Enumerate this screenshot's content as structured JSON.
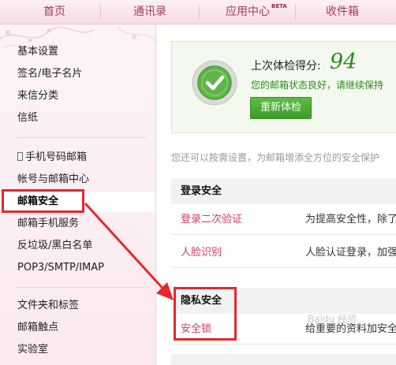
{
  "topnav": {
    "items": [
      {
        "label": "首页"
      },
      {
        "label": "通讯录"
      },
      {
        "label": "应用中心",
        "badge": "BETA"
      },
      {
        "label": "收件箱"
      }
    ]
  },
  "sidebar": {
    "group1": [
      "基本设置",
      "签名/电子名片",
      "来信分类",
      "信纸"
    ],
    "group2": [
      "手机号码邮箱",
      "帐号与邮箱中心",
      "邮箱安全",
      "邮箱手机服务",
      "反垃圾/黑白名单",
      "POP3/SMTP/IMAP"
    ],
    "group3": [
      "文件夹和标签",
      "邮箱触点",
      "实验室"
    ]
  },
  "score": {
    "label": "上次体检得分:",
    "value": "94",
    "desc": "您的邮箱状态良好，请继续保持",
    "button": "重新体检"
  },
  "intro": "您还可以按需设置，为邮箱增添全方位的安全保护",
  "sections": [
    {
      "title": "登录安全",
      "rows": [
        {
          "name": "登录二次验证",
          "desc": "为提高安全性，除了"
        },
        {
          "name": "人脸识别",
          "desc": "人脸认证登录，加强"
        }
      ]
    },
    {
      "title": "隐私安全",
      "rows": [
        {
          "name": "安全锁",
          "desc": "给重要的资料加安全"
        }
      ]
    }
  ],
  "watermark": "Baidu 经验",
  "colors": {
    "nav_text": "#a23d5c",
    "link": "#d43a63",
    "score_green": "#2e8b1d",
    "annotation_red": "#e8262c"
  }
}
